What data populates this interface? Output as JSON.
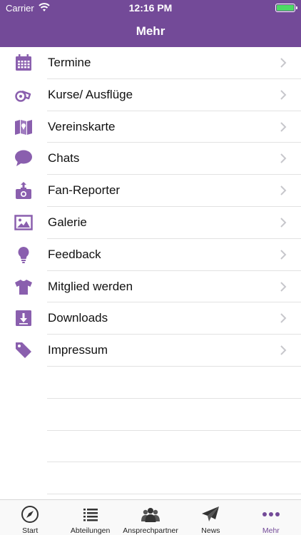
{
  "status_bar": {
    "carrier": "Carrier",
    "time": "12:16 PM"
  },
  "nav": {
    "title": "Mehr"
  },
  "menu": [
    {
      "label": "Termine",
      "icon": "calendar-icon"
    },
    {
      "label": "Kurse/ Ausflüge",
      "icon": "whistle-icon"
    },
    {
      "label": "Vereinskarte",
      "icon": "map-icon"
    },
    {
      "label": "Chats",
      "icon": "chat-bubble-icon"
    },
    {
      "label": "Fan-Reporter",
      "icon": "camera-upload-icon"
    },
    {
      "label": "Galerie",
      "icon": "image-icon"
    },
    {
      "label": "Feedback",
      "icon": "lightbulb-icon"
    },
    {
      "label": "Mitglied werden",
      "icon": "shirt-icon"
    },
    {
      "label": "Downloads",
      "icon": "download-icon"
    },
    {
      "label": "Impressum",
      "icon": "tag-icon"
    }
  ],
  "tabs": [
    {
      "label": "Start",
      "icon": "compass-icon"
    },
    {
      "label": "Abteilungen",
      "icon": "list-icon"
    },
    {
      "label": "Ansprechpartner",
      "icon": "people-icon"
    },
    {
      "label": "News",
      "icon": "paper-plane-icon"
    },
    {
      "label": "Mehr",
      "icon": "more-dots-icon",
      "active": true
    }
  ],
  "colors": {
    "accent": "#734a98",
    "icon": "#8a5fae",
    "battery": "#4cd964"
  }
}
